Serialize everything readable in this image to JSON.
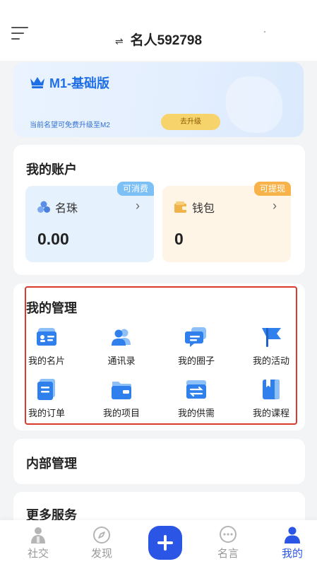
{
  "header": {
    "switch_icon": "⇌",
    "title": "名人592798",
    "menu_icon": "hamburger-icon"
  },
  "member": {
    "title": "M1-基础版",
    "subtitle": "当前名望可免费升级至M2",
    "upgrade_label": "去升级"
  },
  "account": {
    "title": "我的账户",
    "pearl": {
      "label": "名珠",
      "badge": "可消费",
      "value": "0.00",
      "chevron": "›"
    },
    "wallet": {
      "label": "钱包",
      "badge": "可提现",
      "value": "0",
      "chevron": "›"
    }
  },
  "management": {
    "title": "我的管理",
    "items": [
      {
        "label": "我的名片",
        "icon": "business-card-icon"
      },
      {
        "label": "通讯录",
        "icon": "contacts-icon"
      },
      {
        "label": "我的圈子",
        "icon": "circle-chat-icon"
      },
      {
        "label": "我的活动",
        "icon": "activity-flag-icon"
      },
      {
        "label": "我的订单",
        "icon": "order-icon"
      },
      {
        "label": "我的项目",
        "icon": "project-folder-icon"
      },
      {
        "label": "我的供需",
        "icon": "supply-demand-icon"
      },
      {
        "label": "我的课程",
        "icon": "course-book-icon"
      }
    ]
  },
  "internal": {
    "title": "内部管理"
  },
  "more": {
    "title": "更多服务"
  },
  "nav": {
    "items": [
      {
        "label": "社交",
        "icon": "social-icon"
      },
      {
        "label": "发现",
        "icon": "compass-icon"
      },
      {
        "label": "名言",
        "icon": "quote-chat-icon"
      },
      {
        "label": "我的",
        "icon": "profile-icon"
      }
    ],
    "active": "我的",
    "colors": {
      "active": "#2a55e5",
      "inactive": "#999999"
    }
  },
  "colors": {
    "brand_blue": "#1f6fe6",
    "highlight_border": "#d83a2e",
    "upgrade_yellow": "#f7d36b"
  }
}
